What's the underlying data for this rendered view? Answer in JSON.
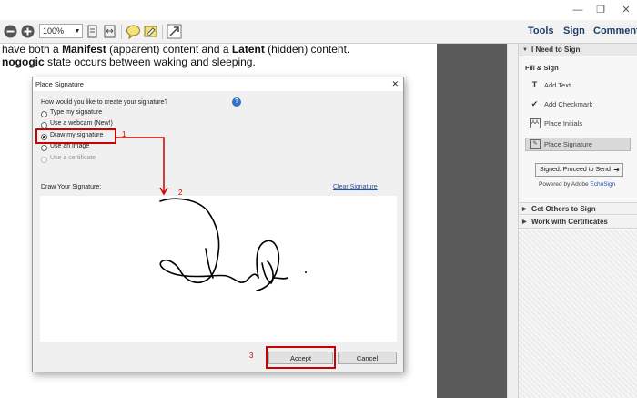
{
  "window": {
    "minimize": "—",
    "restore": "❐",
    "close": "✕"
  },
  "toolbar": {
    "zoom": "100%",
    "tabs": {
      "tools": "Tools",
      "sign": "Sign",
      "comment": "Comment"
    }
  },
  "document": {
    "line1_pre": "have both a ",
    "line1_b1": "Manifest",
    "line1_mid": " (apparent) content and a ",
    "line1_b2": "Latent",
    "line1_post": " (hidden) content.",
    "line2_b": "nogogic",
    "line2_post": " state occurs between waking and sleeping."
  },
  "panel": {
    "i_need_to_sign": "I Need to Sign",
    "fill_sign": "Fill & Sign",
    "add_text": "Add Text",
    "add_checkmark": "Add Checkmark",
    "place_initials": "Place Initials",
    "place_signature": "Place Signature",
    "signed_proceed": "Signed. Proceed to Send",
    "powered_by": "Powered by Adobe ",
    "echosign": "EchoSign",
    "get_others": "Get Others to Sign",
    "work_with_certs": "Work with Certificates"
  },
  "dialog": {
    "title": "Place Signature",
    "close": "✕",
    "question": "How would you like to create your signature?",
    "help": "?",
    "options": [
      "Type my signature",
      "Use a webcam (New!)",
      "Draw my signature",
      "Use an image",
      "Use a certificate"
    ],
    "selected_index": 2,
    "draw_label": "Draw Your Signature:",
    "clear": "Clear Signature",
    "accept": "Accept",
    "cancel": "Cancel"
  },
  "annotations": {
    "step1": "1",
    "step2": "2",
    "step3": "3"
  },
  "colors": {
    "annotation_red": "#c00000",
    "link_blue": "#1f4fb0"
  }
}
